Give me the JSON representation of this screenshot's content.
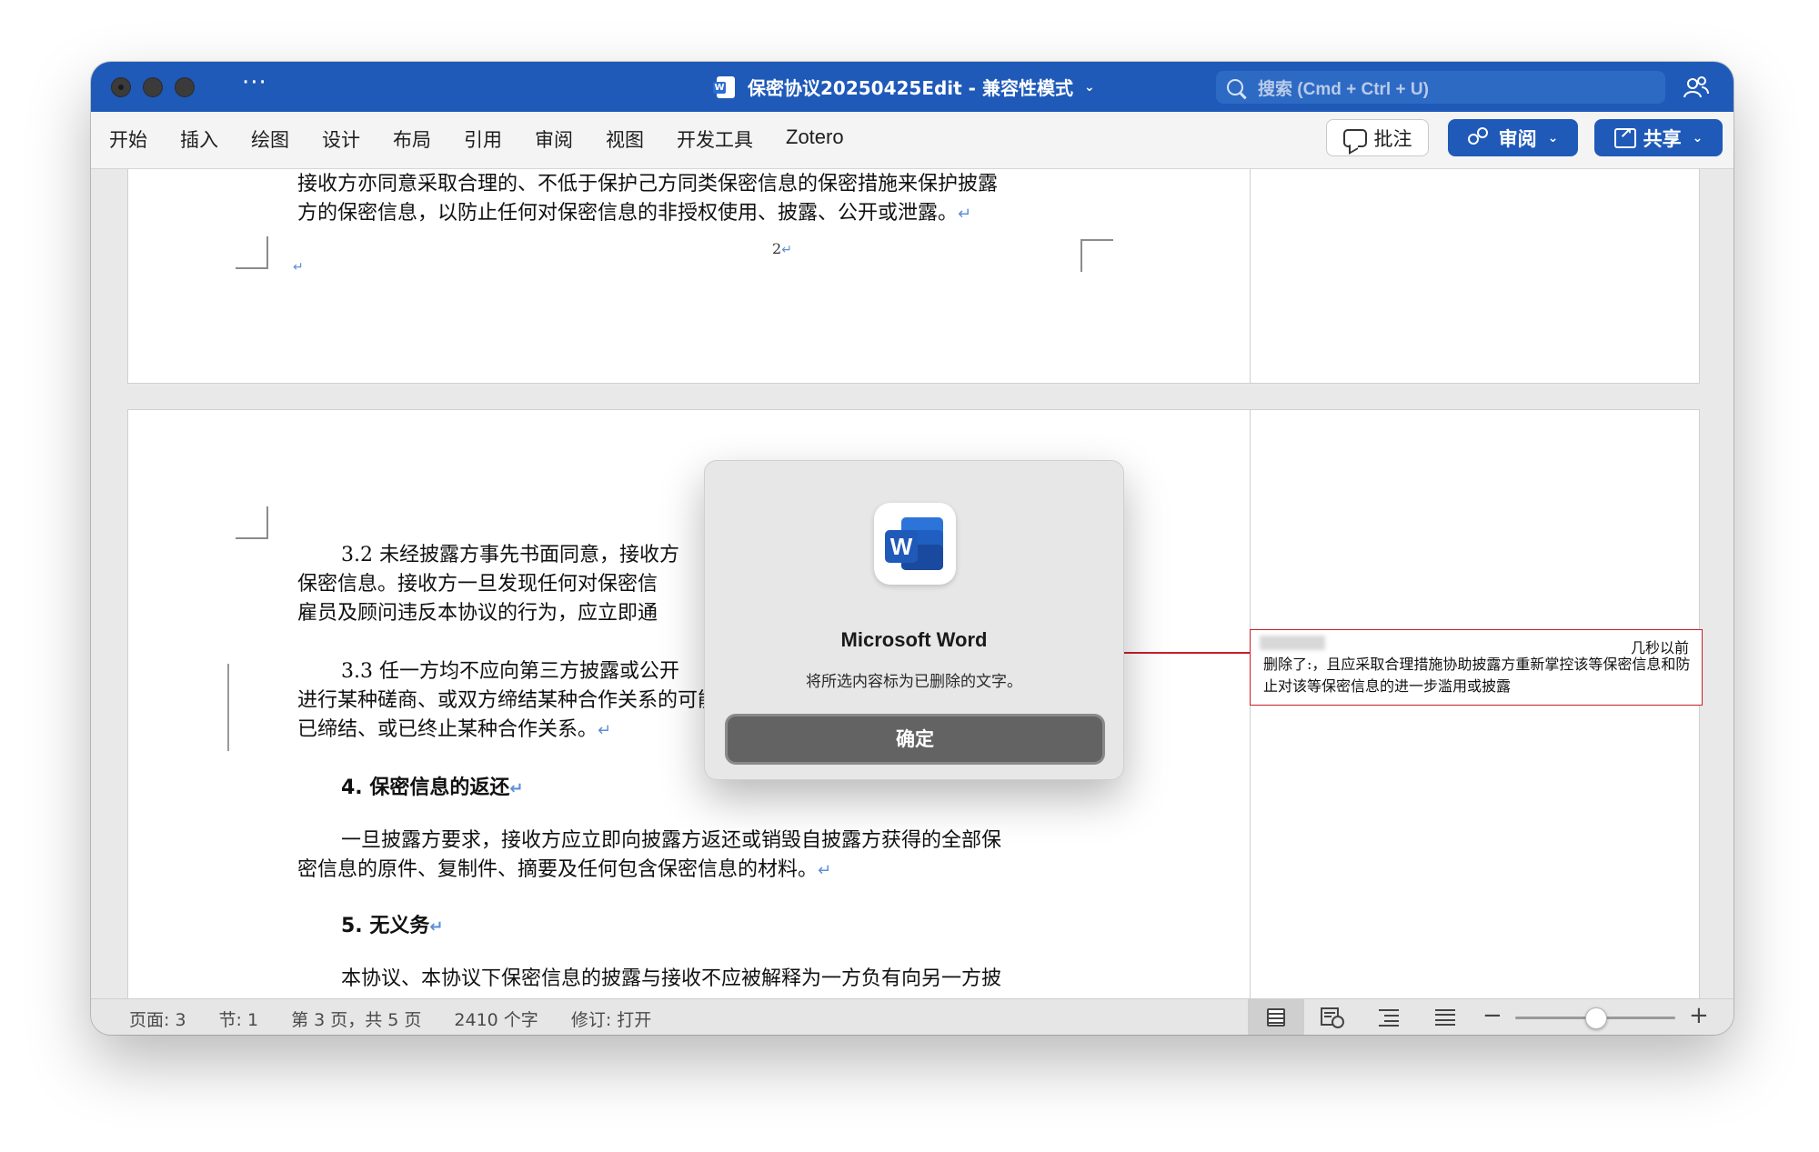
{
  "window": {
    "title": "保密协议20250425Edit - 兼容性模式",
    "search_placeholder": "搜索 (Cmd + Ctrl + U)",
    "more_label": "···"
  },
  "ribbon": {
    "tabs": [
      "开始",
      "插入",
      "绘图",
      "设计",
      "布局",
      "引用",
      "审阅",
      "视图",
      "开发工具",
      "Zotero"
    ],
    "comment_label": "批注",
    "review_label": "审阅",
    "share_label": "共享"
  },
  "document": {
    "page1": {
      "para_line1": "接收方亦同意采取合理的、不低于保护己方同类保密信息的保密措施来保护披露",
      "para_line2": "方的保密信息，以防止任何对保密信息的非授权使用、披露、公开或泄露。",
      "page_number": "2"
    },
    "page2": {
      "p32_line1": "3.2 未经披露方事先书面同意，接收方",
      "p32_line2": "保密信息。接收方一旦发现任何对保密信",
      "p32_line3": "雇员及顾问违反本协议的行为，应立即通",
      "p33_line1": "3.3 任一方均不应向第三方披露或公开",
      "p33_line2": "进行某种磋商、或双方缔结某种合作关系的可能性；或（2）双方即将缔结、或",
      "p33_line3": "已缔结、或已终止某种合作关系。",
      "heading4": "4. 保密信息的返还",
      "p4_line1": "一旦披露方要求，接收方应立即向披露方返还或销毁自披露方获得的全部保",
      "p4_line2": "密信息的原件、复制件、摘要及任何包含保密信息的材料。",
      "heading5": "5. 无义务",
      "p5_line1": "本协议、本协议下保密信息的披露与接收不应被解释为一方负有向另一方披"
    },
    "paragraph_mark": "↵"
  },
  "comment": {
    "time": "几秒以前",
    "text": "删除了:，且应采取合理措施协助披露方重新掌控该等保密信息和防止对该等保密信息的进一步滥用或披露"
  },
  "dialog": {
    "app_name": "Microsoft Word",
    "message": "将所选内容标为已删除的文字。",
    "ok_label": "确定"
  },
  "statusbar": {
    "page": "页面: 3",
    "section": "节: 1",
    "page_of": "第 3 页，共 5 页",
    "word_count": "2410 个字",
    "track_changes": "修订: 打开"
  }
}
